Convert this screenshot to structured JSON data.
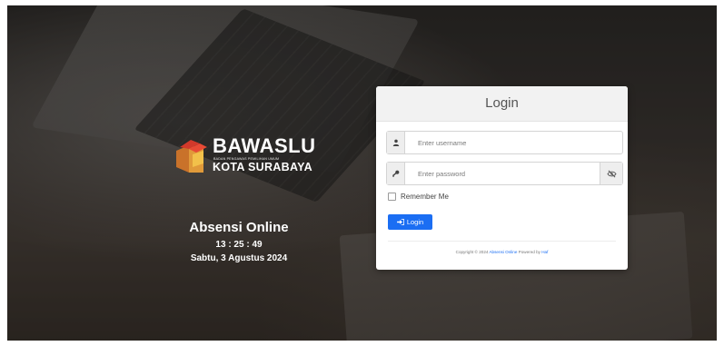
{
  "brand": {
    "name": "BAWASLU",
    "subtitle": "BADAN PENGAWAS PEMILIHAN UMUM",
    "city": "KOTA SURABAYA"
  },
  "info": {
    "app_title": "Absensi Online",
    "clock": "13 : 25 : 49",
    "date": "Sabtu, 3 Agustus 2024"
  },
  "login": {
    "title": "Login",
    "username_placeholder": "Enter username",
    "password_placeholder": "Enter password",
    "remember_label": "Remember Me",
    "button_label": "Login",
    "button_color": "#1b6ef3"
  },
  "footer": {
    "prefix": "Copyright © 2024",
    "app_link": "Absensi Online",
    "middle": "Powered by",
    "author_link": "Haf"
  },
  "icons": {
    "username": "user-icon",
    "password": "key-icon",
    "toggle": "eye-slash-icon",
    "button": "sign-in-icon"
  }
}
